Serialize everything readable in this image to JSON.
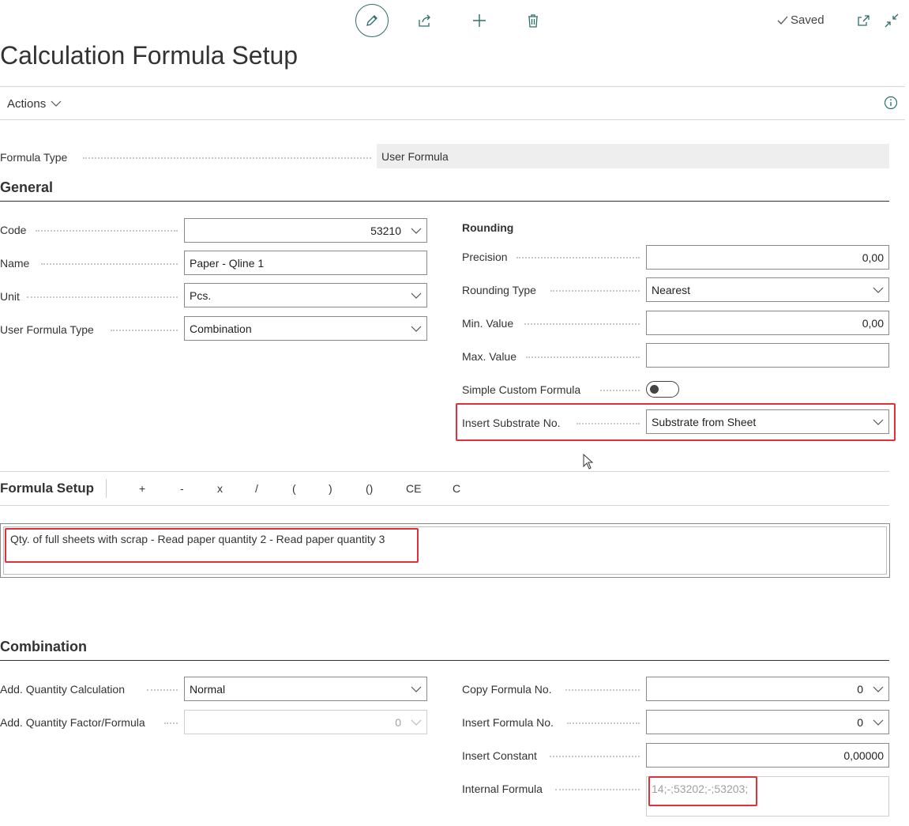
{
  "toolbar": {
    "saved_label": "Saved"
  },
  "page": {
    "title": "Calculation Formula Setup"
  },
  "actions_bar": {
    "actions_label": "Actions"
  },
  "formula_type": {
    "label": "Formula Type",
    "value": "User Formula"
  },
  "general": {
    "title": "General",
    "code": {
      "label": "Code",
      "value": "53210"
    },
    "name": {
      "label": "Name",
      "value": "Paper - Qline 1"
    },
    "unit": {
      "label": "Unit",
      "value": "Pcs."
    },
    "user_formula_type": {
      "label": "User Formula Type",
      "value": "Combination"
    }
  },
  "rounding": {
    "title": "Rounding",
    "precision": {
      "label": "Precision",
      "value": "0,00"
    },
    "rounding_type": {
      "label": "Rounding Type",
      "value": "Nearest"
    },
    "min_value": {
      "label": "Min. Value",
      "value": "0,00"
    },
    "max_value": {
      "label": "Max. Value",
      "value": ""
    },
    "simple_custom_formula": {
      "label": "Simple Custom Formula",
      "on": false
    },
    "insert_substrate_no": {
      "label": "Insert Substrate No.",
      "value": "Substrate from Sheet"
    }
  },
  "formula_setup": {
    "title": "Formula Setup",
    "operators": [
      "+",
      "-",
      "x",
      "/",
      "(",
      ")",
      "()",
      "CE",
      "C"
    ],
    "formula_text": "Qty. of full sheets with scrap - Read paper quantity 2 - Read paper quantity 3"
  },
  "combination": {
    "title": "Combination",
    "add_quantity_calculation": {
      "label": "Add. Quantity Calculation",
      "value": "Normal"
    },
    "add_quantity_factor": {
      "label": "Add. Quantity Factor/Formula",
      "value": "0"
    },
    "copy_formula_no": {
      "label": "Copy Formula No.",
      "value": "0"
    },
    "insert_formula_no": {
      "label": "Insert Formula No.",
      "value": "0"
    },
    "insert_constant": {
      "label": "Insert Constant",
      "value": "0,00000"
    },
    "internal_formula": {
      "label": "Internal Formula",
      "value": "14;-;53202;-;53203;"
    }
  },
  "colors": {
    "accent": "#2b6e6a",
    "highlight": "#e0303a",
    "readonly_bg": "#eeeeee"
  }
}
